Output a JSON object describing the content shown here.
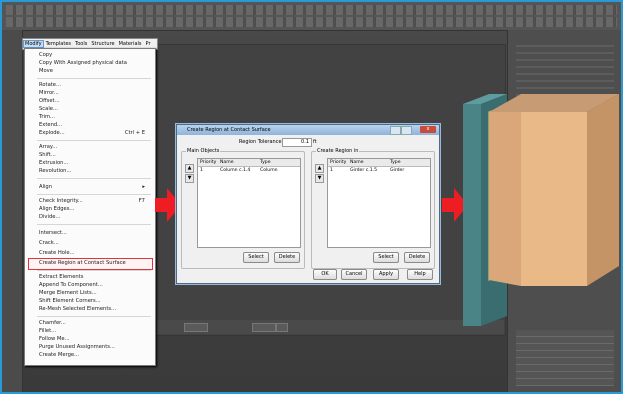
{
  "menubar": {
    "items": [
      "Modify",
      "Templates",
      "Tools",
      "Structure",
      "Materials",
      "Pr"
    ]
  },
  "menu": {
    "items": [
      {
        "label": "Copy"
      },
      {
        "label": "Copy With Assigned physical data"
      },
      {
        "label": "Move"
      },
      {
        "label": "Rotate..."
      },
      {
        "label": "Mirror..."
      },
      {
        "label": "Offset..."
      },
      {
        "label": "Scale..."
      },
      {
        "label": "Trim..."
      },
      {
        "label": "Extend..."
      },
      {
        "label": "Explode...",
        "shortcut": "Ctrl + E"
      },
      {
        "label": "Array..."
      },
      {
        "label": "Shift..."
      },
      {
        "label": "Extrusion..."
      },
      {
        "label": "Revolution..."
      },
      {
        "label": "Align",
        "shortcut": "▸"
      },
      {
        "label": "Check Integrity...",
        "shortcut": "F7"
      },
      {
        "label": "Align Edges..."
      },
      {
        "label": "Divide..."
      },
      {
        "label": "Intersect..."
      },
      {
        "label": "Crack..."
      },
      {
        "label": "Create Hole..."
      },
      {
        "label": "Create Region at Contact Surface"
      },
      {
        "label": "Extract Elements"
      },
      {
        "label": "Append To Component..."
      },
      {
        "label": "Merge Element Lists..."
      },
      {
        "label": "Shift Element Corners..."
      },
      {
        "label": "Re-Mesh Selected Elements..."
      },
      {
        "label": "Chamfer..."
      },
      {
        "label": "Fillet..."
      },
      {
        "label": "Follow Me..."
      },
      {
        "label": "Purge Unused Assignments..."
      },
      {
        "label": "Create Merge..."
      }
    ]
  },
  "dialog": {
    "title": "Create Region at Contact Surface",
    "gap_label": "Region Tolerance",
    "gap_value": "0.1",
    "gap_unit": "ft",
    "main_group_title": "Main Objects",
    "create_group_title": "Create Region in",
    "headers": [
      "Priority",
      "Name",
      "Type"
    ],
    "main_row": [
      "1",
      "Column c.1.4",
      "Column"
    ],
    "create_row": [
      "1",
      "Girder c.1.5",
      "Girder"
    ],
    "select_label": "Select",
    "delete_label": "Delete",
    "ok_label": "OK",
    "cancel_label": "Cancel",
    "apply_label": "Apply",
    "help_label": "Help",
    "close_label": "x"
  },
  "colors": {
    "arrow": "#ee1c23",
    "highlight_border": "#e0333e",
    "column_front": "#4b8486",
    "column_side": "#3a6d70",
    "block_front": "#eab988",
    "block_top": "#c79b73",
    "block_side": "#c49466"
  }
}
